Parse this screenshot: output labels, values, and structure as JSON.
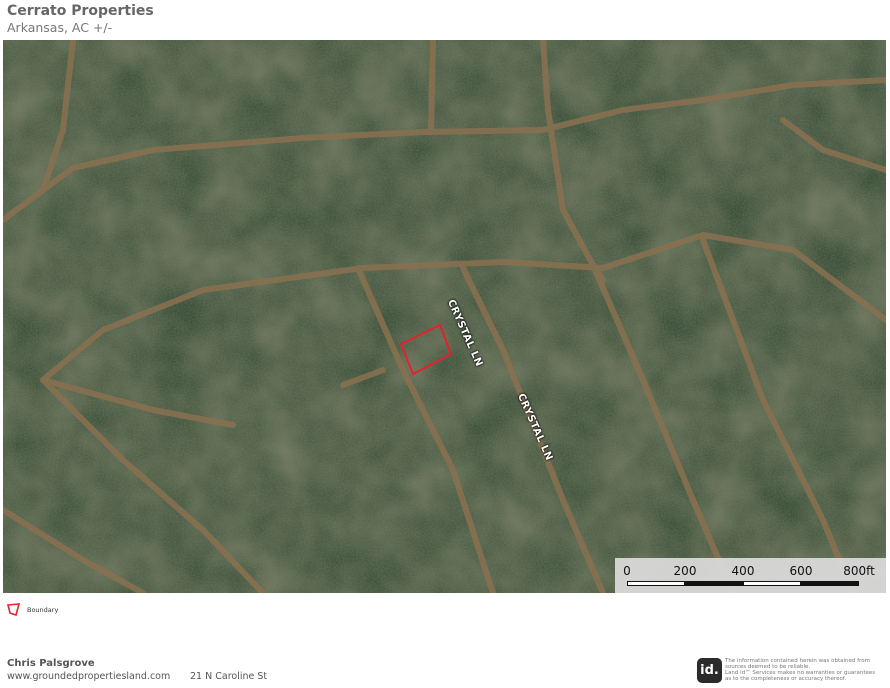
{
  "header": {
    "title": "Cerrato Properties",
    "subtitle": "Arkansas,  AC +/-"
  },
  "map": {
    "road_labels": [
      "CRYSTAL LN",
      "CRYSTAL LN"
    ],
    "boundary_color": "#e8202a",
    "scale": {
      "ticks": [
        "0",
        "200",
        "400",
        "600",
        "800ft"
      ]
    }
  },
  "legend": {
    "boundary_label": "Boundary"
  },
  "footer": {
    "agent_name": "Chris Palsgrove",
    "website": "www.groundedpropertiesland.com",
    "address": "21 N Caroline St",
    "logo_text": "id.",
    "disclaimer": [
      "The information contained herein was obtained from",
      "sources deemed to be reliable.",
      "Land id™ Services makes no warranties or guarantees",
      "as to the completeness or accuracy thereof."
    ]
  }
}
